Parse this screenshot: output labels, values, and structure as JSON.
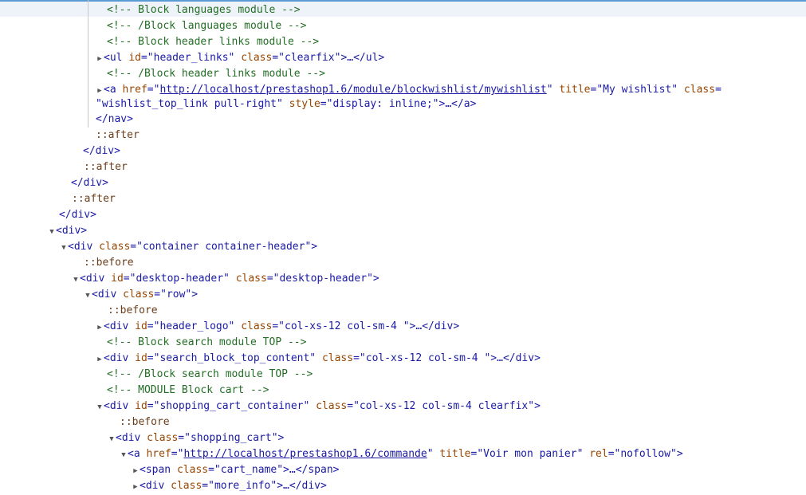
{
  "guide": "",
  "l1": {
    "text": "<!-- Block languages module -->"
  },
  "l2": {
    "text": "<!-- /Block languages module -->"
  },
  "l3": {
    "text": "<!-- Block header links module -->"
  },
  "l4": {
    "open": "<ul",
    "a1n": "id",
    "a1v": "header_links",
    "a2n": "class",
    "a2v": "clearfix",
    "close": ">…</ul>"
  },
  "l5": {
    "text": "<!-- /Block header links module -->"
  },
  "l6": {
    "open": "<a",
    "a1n": "href",
    "a1v": "http://localhost/prestashop1.6/module/blockwishlist/mywishlist",
    "a2n": "title",
    "a2v": "My wishlist",
    "a3n": "class"
  },
  "l6b": {
    "a3v": "wishlist_top_link pull-right",
    "a4n": "style",
    "a4v": "display: inline;",
    "close": ">…</a>"
  },
  "l7": {
    "text": "</nav>"
  },
  "l8": {
    "text": "::after"
  },
  "l9": {
    "text": "</div>"
  },
  "l10": {
    "text": "::after"
  },
  "l11": {
    "text": "</div>"
  },
  "l12": {
    "text": "::after"
  },
  "l13": {
    "text": "</div>"
  },
  "l14": {
    "text": "<div>"
  },
  "l15": {
    "open": "<div",
    "a1n": "class",
    "a1v": "container container-header",
    "close": ">"
  },
  "l16": {
    "text": "::before"
  },
  "l17": {
    "open": "<div",
    "a1n": "id",
    "a1v": "desktop-header",
    "a2n": "class",
    "a2v": "desktop-header",
    "close": ">"
  },
  "l18": {
    "open": "<div",
    "a1n": "class",
    "a1v": "row",
    "close": ">"
  },
  "l19": {
    "text": "::before"
  },
  "l20": {
    "open": "<div",
    "a1n": "id",
    "a1v": "header_logo",
    "a2n": "class",
    "a2v": "col-xs-12 col-sm-4 ",
    "close": ">…</div>"
  },
  "l21": {
    "text": "<!-- Block search module TOP -->"
  },
  "l22": {
    "open": "<div",
    "a1n": "id",
    "a1v": "search_block_top_content",
    "a2n": "class",
    "a2v": "col-xs-12 col-sm-4 ",
    "close": ">…</div>"
  },
  "l23": {
    "text": "<!-- /Block search module TOP -->"
  },
  "l24": {
    "text": "<!-- MODULE Block cart -->"
  },
  "l25": {
    "open": "<div",
    "a1n": "id",
    "a1v": "shopping_cart_container",
    "a2n": "class",
    "a2v": "col-xs-12 col-sm-4 clearfix",
    "close": ">"
  },
  "l26": {
    "text": "::before"
  },
  "l27": {
    "open": "<div",
    "a1n": "class",
    "a1v": "shopping_cart",
    "close": ">"
  },
  "l28": {
    "open": "<a",
    "a1n": "href",
    "a1v": "http://localhost/prestashop1.6/commande",
    "a2n": "title",
    "a2v": "Voir mon panier",
    "a3n": "rel",
    "a3v": "nofollow",
    "close": ">"
  },
  "l29": {
    "open": "<span",
    "a1n": "class",
    "a1v": "cart_name",
    "close": ">…</span>"
  },
  "l30": {
    "open": "<div",
    "a1n": "class",
    "a1v": "more_info",
    "close": ">…</div>"
  }
}
